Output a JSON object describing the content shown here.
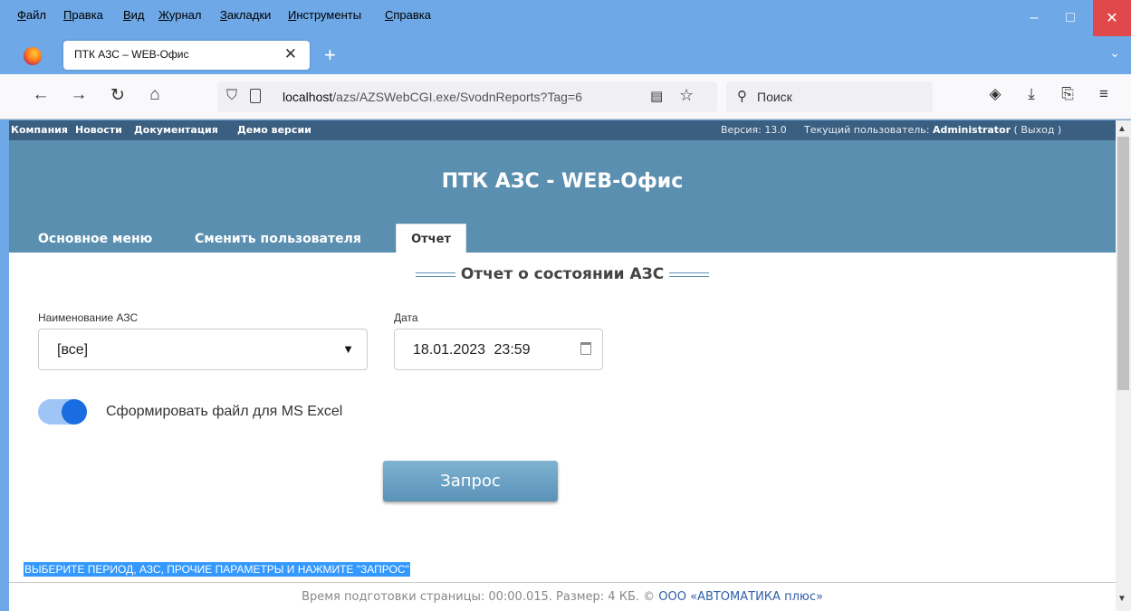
{
  "menubar": {
    "items": [
      {
        "u": "Ф",
        "rest": "айл"
      },
      {
        "u": "П",
        "rest": "равка"
      },
      {
        "u": "В",
        "rest": "ид"
      },
      {
        "u": "Ж",
        "rest": "урнал"
      },
      {
        "u": "З",
        "rest": "акладки"
      },
      {
        "u": "И",
        "rest": "нструменты"
      },
      {
        "u": "С",
        "rest": "правка"
      }
    ]
  },
  "window": {
    "minimize": "–",
    "maximize": "□",
    "close": "✕"
  },
  "tab": {
    "title": "ПТК АЗС – WEB-Офис",
    "close": "✕",
    "new": "+",
    "list": "⌄"
  },
  "nav": {
    "back": "←",
    "forward": "→",
    "reload": "↻",
    "home": "⌂",
    "url_host": "localhost",
    "url_path": "/azs/AZSWebCGI.exe/SvodnReports?Tag=6",
    "search_placeholder": "Поиск",
    "pocket": "◈",
    "download": "⤓",
    "extensions": "⎘",
    "menu": "≡"
  },
  "site": {
    "top_links": [
      "Компания",
      "Новости",
      "Документация",
      "Демо версии"
    ],
    "version": "Версия: 13.0",
    "user_label": "Текущий пользователь: ",
    "user_name": "Administrator",
    "logout": " ( Выход )",
    "title": "ПТК АЗС - WEB-Офис",
    "nav_tabs": [
      "Основное меню",
      "Сменить пользователя"
    ],
    "active_tab": "Отчет"
  },
  "report": {
    "title": "Отчет о состоянии АЗС",
    "station_label": "Наименование АЗС",
    "station_value": "[все]",
    "date_label": "Дата",
    "date_value": "18.01.2023 23:59",
    "excel_toggle_on": true,
    "excel_label": "Сформировать файл для MS Excel",
    "submit": "Запрос",
    "hint": "ВЫБЕРИТЕ ПЕРИОД, АЗС, ПРОЧИЕ ПАРАМЕТРЫ И НАЖМИТЕ \"ЗАПРОС\""
  },
  "footer": {
    "text": "Время подготовки страницы: 00:00.015. Размер: 4 КБ. © ",
    "company": "ООО «АВТОМАТИКА плюс»"
  }
}
